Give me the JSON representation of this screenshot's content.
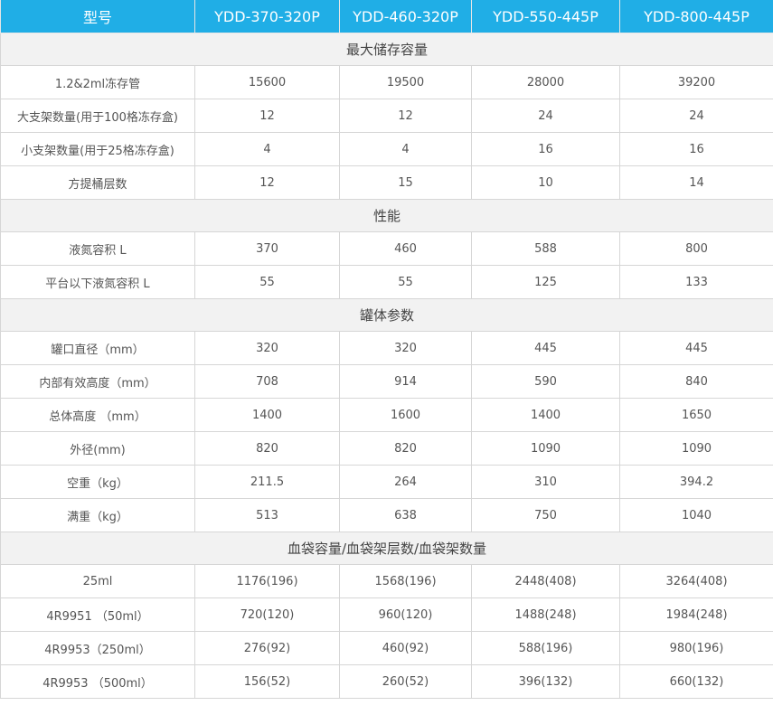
{
  "header": [
    "型号",
    "YDD-370-320P",
    "YDD-460-320P",
    "YDD-550-445P",
    "YDD-800-445P"
  ],
  "sections": [
    {
      "title": "最大储存容量",
      "rows": [
        [
          "1.2&2ml冻存管",
          "15600",
          "19500",
          "28000",
          "39200"
        ],
        [
          "大支架数量(用于100格冻存盒)",
          "12",
          "12",
          "24",
          "24"
        ],
        [
          "小支架数量(用于25格冻存盒)",
          "4",
          "4",
          "16",
          "16"
        ],
        [
          "方提桶层数",
          "12",
          "15",
          "10",
          "14"
        ]
      ]
    },
    {
      "title": "性能",
      "rows": [
        [
          "液氮容积 L",
          "370",
          "460",
          "588",
          "800"
        ],
        [
          "平台以下液氮容积 L",
          "55",
          "55",
          "125",
          "133"
        ]
      ]
    },
    {
      "title": "罐体参数",
      "rows": [
        [
          "罐口直径（mm）",
          "320",
          "320",
          "445",
          "445"
        ],
        [
          "内部有效高度（mm）",
          "708",
          "914",
          "590",
          "840"
        ],
        [
          "总体高度 （mm）",
          "1400",
          "1600",
          "1400",
          "1650"
        ],
        [
          "外径(mm)",
          "820",
          "820",
          "1090",
          "1090"
        ],
        [
          "空重（kg）",
          "211.5",
          "264",
          "310",
          "394.2"
        ],
        [
          "满重（kg）",
          "513",
          "638",
          "750",
          "1040"
        ]
      ]
    },
    {
      "title": "血袋容量/血袋架层数/血袋架数量",
      "rows": [
        [
          "25ml",
          "1176(196)",
          "1568(196)",
          "2448(408)",
          "3264(408)"
        ],
        [
          "4R9951 （50ml）",
          "720(120)",
          "960(120)",
          "1488(248)",
          "1984(248)"
        ],
        [
          "4R9953（250ml）",
          "276(92)",
          "460(92)",
          "588(196)",
          "980(196)"
        ],
        [
          "4R9953 （500ml）",
          "156(52)",
          "260(52)",
          "396(132)",
          "660(132)"
        ]
      ]
    }
  ],
  "colors": {
    "header_bg": "#20aee6",
    "section_bg": "#f2f2f2",
    "border": "#d6d6d6",
    "text": "#555555"
  }
}
